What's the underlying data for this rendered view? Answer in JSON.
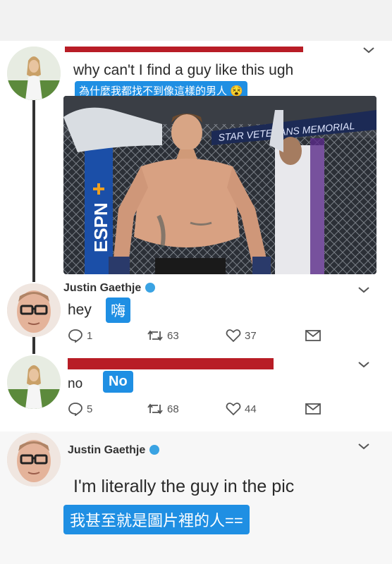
{
  "tweets": [
    {
      "text": "why can't I find a guy like this ugh",
      "subtitle": "為什麼我都找不到像這樣的男人 😵",
      "photo": {
        "banner_text": "STAR VETERANS MEMORIAL"
      }
    },
    {
      "author": "Justin Gaethje",
      "text": "hey",
      "subtitle": "嗨",
      "stats": {
        "replies": "1",
        "retweets": "63",
        "likes": "37"
      }
    },
    {
      "text": "no",
      "subtitle": "No",
      "stats": {
        "replies": "5",
        "retweets": "68",
        "likes": "44"
      }
    },
    {
      "author": "Justin Gaethje",
      "text": "I'm literally the guy in the pic",
      "subtitle": "我甚至就是圖片裡的人=="
    }
  ],
  "icons": {
    "menu": "chevron-down-icon",
    "reply": "reply-icon",
    "retweet": "retweet-icon",
    "like": "heart-icon",
    "message": "message-icon"
  },
  "colors": {
    "subtitle_bg": "#1f8fe3",
    "redaction": "#b81d26",
    "verified": "#3aa3e3"
  }
}
